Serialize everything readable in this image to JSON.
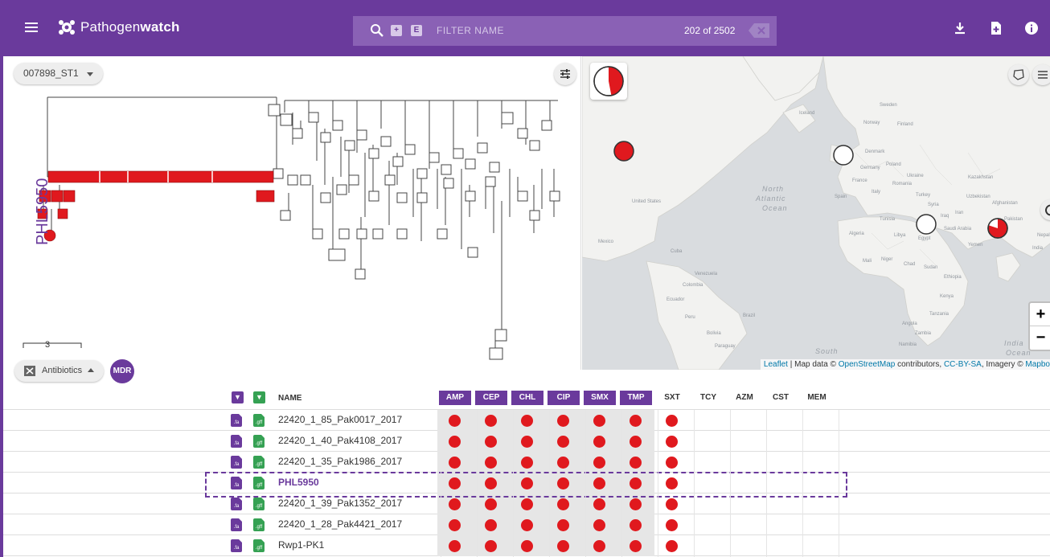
{
  "app": {
    "name_light": "Pathogen",
    "name_bold": "watch",
    "search_placeholder": "FILTER NAME",
    "search_chip_plus": "+",
    "search_chip_e": "E",
    "count_text": "202 of 2502"
  },
  "tree": {
    "selector_label": "007898_ST1",
    "highlighted_leaf": "PHL5950",
    "scale_value": "3"
  },
  "map": {
    "ocean_labels": [
      "North",
      "Atlantic",
      "Ocean",
      "South",
      "India",
      "Ocean"
    ],
    "country_labels": [
      "United States",
      "Mexico",
      "Cuba",
      "Venezuela",
      "Colombia",
      "Peru",
      "Bolivia",
      "Brazil",
      "Paraguay",
      "Ecuador",
      "Iceland",
      "Norway",
      "Sweden",
      "Finland",
      "Denmark",
      "Germany",
      "Poland",
      "Ukraine",
      "France",
      "Spain",
      "Italy",
      "Romania",
      "Turkey",
      "Kazakhstan",
      "Uzbekistan",
      "Iran",
      "Iraq",
      "Syria",
      "Egypt",
      "Libya",
      "Algeria",
      "Tunisia",
      "Mali",
      "Niger",
      "Chad",
      "Sudan",
      "Ethiopia",
      "Kenya",
      "Tanzania",
      "Angola",
      "Zambia",
      "Namibia",
      "Saudi Arabia",
      "Yemen",
      "India",
      "Nepal",
      "Afghanistan",
      "Pakistan"
    ],
    "zoom_in": "+",
    "zoom_out": "−",
    "attribution": {
      "leaflet": "Leaflet",
      "sep1": " | Map data © ",
      "osm": "OpenStreetMap",
      "sep2": " contributors, ",
      "license": "CC-BY-SA",
      "sep3": ", Imagery © ",
      "mapbox": "Mapbo"
    },
    "pie_markers": [
      {
        "label": "United States",
        "resistant_fraction": 1.0
      },
      {
        "label": "United Kingdom",
        "resistant_fraction": 0.0
      },
      {
        "label": "Egypt",
        "resistant_fraction": 0.0
      },
      {
        "label": "Pakistan",
        "resistant_fraction": 0.8
      }
    ],
    "overall_resistant_fraction": 0.45
  },
  "antibiotics_control": {
    "label": "Antibiotics",
    "mdr_label": "MDR"
  },
  "table": {
    "name_header": "NAME",
    "fa_label": ".fa",
    "gff_label": ".gff",
    "antibiotics": [
      {
        "code": "AMP",
        "resistant": true
      },
      {
        "code": "CEP",
        "resistant": true
      },
      {
        "code": "CHL",
        "resistant": true
      },
      {
        "code": "CIP",
        "resistant": true
      },
      {
        "code": "SMX",
        "resistant": true
      },
      {
        "code": "TMP",
        "resistant": true
      },
      {
        "code": "SXT",
        "resistant": false
      },
      {
        "code": "TCY",
        "resistant": false
      },
      {
        "code": "AZM",
        "resistant": false
      },
      {
        "code": "CST",
        "resistant": false
      },
      {
        "code": "MEM",
        "resistant": false
      }
    ],
    "rows": [
      {
        "name": "22420_1_85_Pak0017_2017",
        "highlighted": false,
        "results": [
          1,
          1,
          1,
          1,
          1,
          1,
          1,
          0,
          0,
          0,
          0
        ]
      },
      {
        "name": "22420_1_40_Pak4108_2017",
        "highlighted": false,
        "results": [
          1,
          1,
          1,
          1,
          1,
          1,
          1,
          0,
          0,
          0,
          0
        ]
      },
      {
        "name": "22420_1_35_Pak1986_2017",
        "highlighted": false,
        "results": [
          1,
          1,
          1,
          1,
          1,
          1,
          1,
          0,
          0,
          0,
          0
        ]
      },
      {
        "name": "PHL5950",
        "highlighted": true,
        "results": [
          1,
          1,
          1,
          1,
          1,
          1,
          1,
          0,
          0,
          0,
          0
        ]
      },
      {
        "name": "22420_1_39_Pak1352_2017",
        "highlighted": false,
        "results": [
          1,
          1,
          1,
          1,
          1,
          1,
          1,
          0,
          0,
          0,
          0
        ]
      },
      {
        "name": "22420_1_28_Pak4421_2017",
        "highlighted": false,
        "results": [
          1,
          1,
          1,
          1,
          1,
          1,
          1,
          0,
          0,
          0,
          0
        ]
      },
      {
        "name": "Rwp1-PK1",
        "highlighted": false,
        "results": [
          1,
          1,
          1,
          1,
          1,
          1,
          1,
          0,
          0,
          0,
          0
        ]
      }
    ]
  },
  "colors": {
    "brand": "#6a3a9c",
    "resistant": "#e0191e",
    "gff": "#35a153",
    "map_land": "#f2f2f0",
    "map_water": "#d9dcdf"
  }
}
